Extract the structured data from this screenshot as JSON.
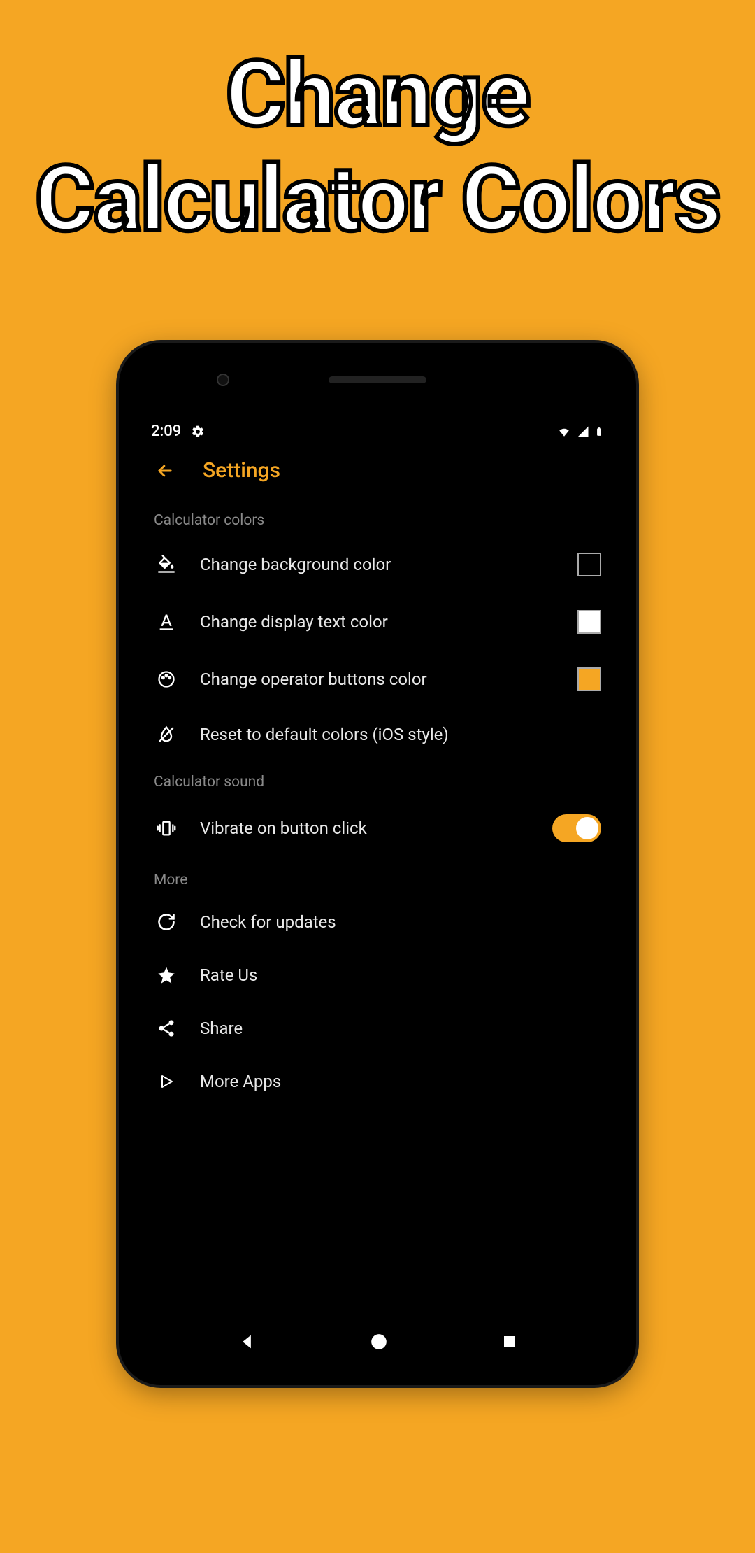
{
  "headline": {
    "line1": "Change",
    "line2": "Calculator Colors"
  },
  "status": {
    "time": "2:09"
  },
  "appbar": {
    "title": "Settings"
  },
  "sections": {
    "colors": {
      "header": "Calculator colors",
      "bg_label": "Change background color",
      "text_label": "Change display text color",
      "op_label": "Change operator buttons color",
      "reset_label": "Reset to default colors (iOS style)",
      "bg_swatch": "#000000",
      "text_swatch": "#ffffff",
      "op_swatch": "#f5a623"
    },
    "sound": {
      "header": "Calculator sound",
      "vibrate_label": "Vibrate on button click",
      "vibrate_on": true
    },
    "more": {
      "header": "More",
      "update_label": "Check for updates",
      "rate_label": "Rate Us",
      "share_label": "Share",
      "apps_label": "More Apps"
    }
  },
  "colors": {
    "accent": "#f5a623"
  }
}
